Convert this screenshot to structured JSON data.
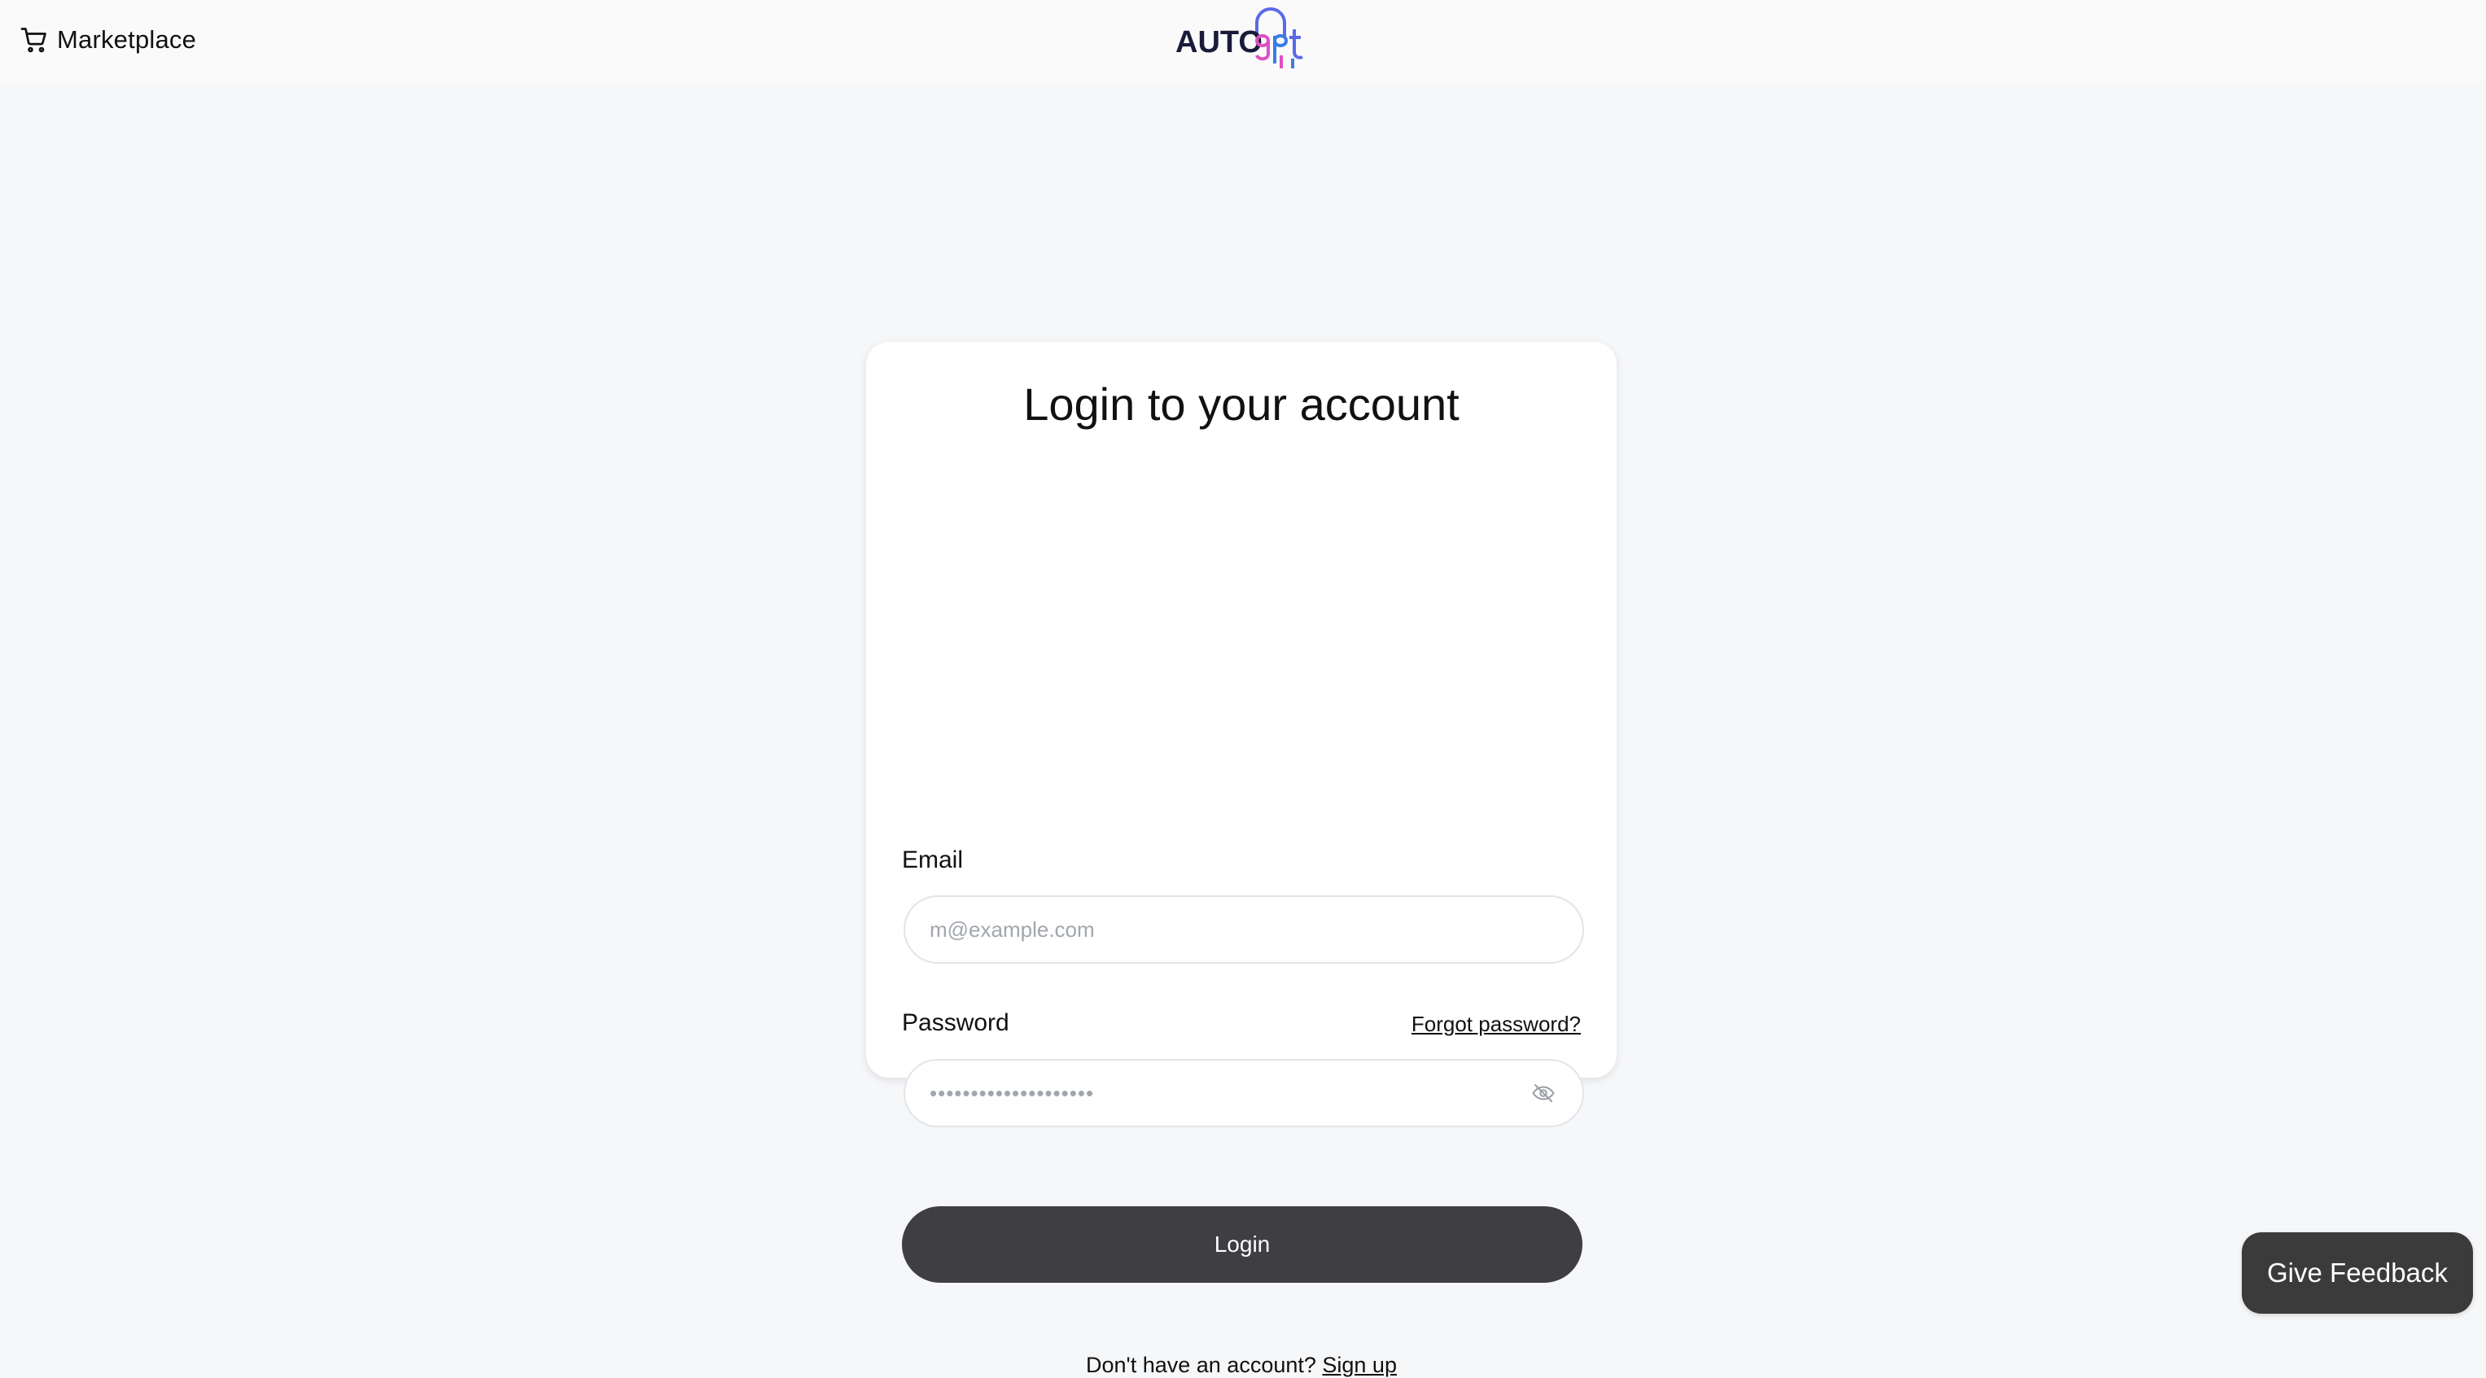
{
  "header": {
    "marketplace_label": "Marketplace",
    "marketplace_icon": "shopping-cart-icon",
    "logo_text": "AUTOgpt",
    "logo_colors": {
      "text": "#1a1a3a",
      "arch": "#5b6ae8",
      "accent_pink": "#e04fc4",
      "accent_blue": "#3b7be8"
    }
  },
  "login": {
    "title": "Login to your account",
    "email_label": "Email",
    "email_placeholder": "m@example.com",
    "email_value": "",
    "password_label": "Password",
    "forgot_password": "Forgot password?",
    "password_placeholder": "••••••••••••••••••••",
    "password_toggle_icon": "eye-off-icon",
    "submit_label": "Login",
    "signup_prompt": "Don't have an account?",
    "signup_link": "Sign up"
  },
  "feedback": {
    "label": "Give Feedback"
  },
  "colors": {
    "background": "#f6f7f9",
    "card": "#ffffff",
    "button_dark": "#3e3e43",
    "input_border": "#e2e4e8"
  }
}
